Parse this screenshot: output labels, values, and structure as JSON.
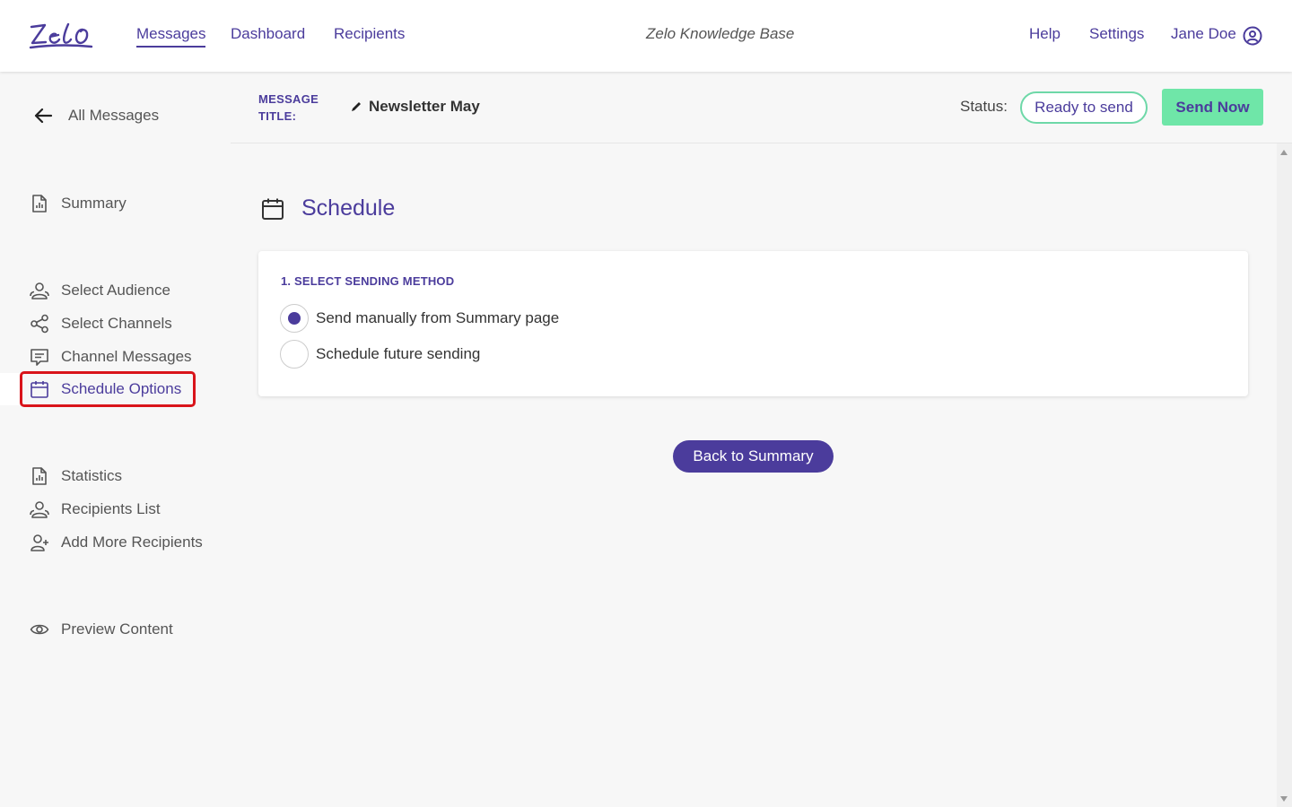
{
  "app": {
    "logo_text": "Zelo"
  },
  "topnav": {
    "links": [
      "Messages",
      "Dashboard",
      "Recipients"
    ],
    "knowledge_base": "Zelo Knowledge Base",
    "right_links": [
      "Help",
      "Settings"
    ],
    "user_name": "Jane Doe"
  },
  "sidebar": {
    "back_label": "All Messages",
    "items": [
      {
        "label": "Summary",
        "icon": "report-icon"
      },
      {
        "label": "Select Audience",
        "icon": "users-icon"
      },
      {
        "label": "Select Channels",
        "icon": "share-icon"
      },
      {
        "label": "Channel Messages",
        "icon": "message-icon"
      },
      {
        "label": "Schedule Options",
        "icon": "calendar-icon",
        "active": true
      },
      {
        "label": "Statistics",
        "icon": "report-icon"
      },
      {
        "label": "Recipients List",
        "icon": "users-icon"
      },
      {
        "label": "Add More Recipients",
        "icon": "user-add-icon"
      },
      {
        "label": "Preview Content",
        "icon": "eye-icon"
      }
    ]
  },
  "message_header": {
    "label": "MESSAGE TITLE:",
    "title": "Newsletter May",
    "status_label": "Status:",
    "status_value": "Ready to send",
    "send_button": "Send Now"
  },
  "schedule": {
    "title": "Schedule",
    "section_heading": "1. SELECT SENDING METHOD",
    "options": [
      {
        "label": "Send manually from Summary page",
        "selected": true
      },
      {
        "label": "Schedule future sending",
        "selected": false
      }
    ],
    "back_button": "Back to Summary"
  },
  "colors": {
    "brand": "#4b3c9c",
    "accent_green": "#6fe6a8",
    "highlight_red": "#d9141a"
  }
}
